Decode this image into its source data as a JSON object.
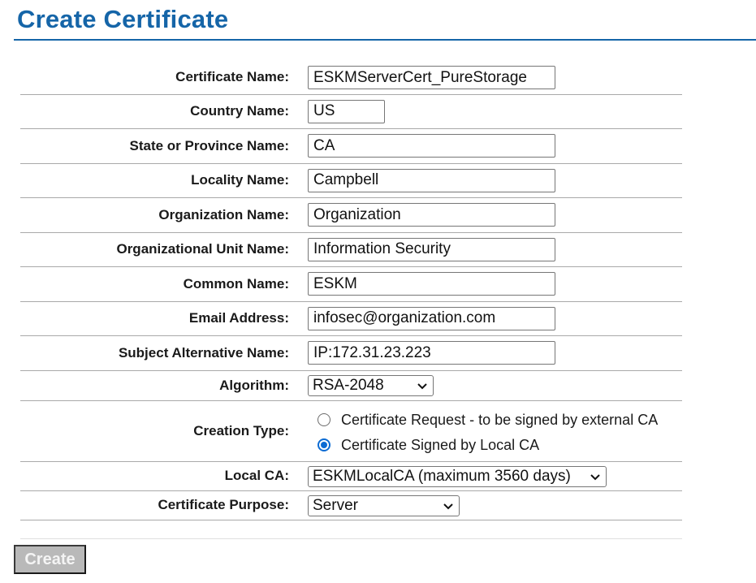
{
  "page": {
    "title": "Create Certificate",
    "accent_color": "#1565a8"
  },
  "form": {
    "certificate_name": {
      "label": "Certificate Name:",
      "value": "ESKMServerCert_PureStorage"
    },
    "country_name": {
      "label": "Country Name:",
      "value": "US"
    },
    "state_name": {
      "label": "State or Province Name:",
      "value": "CA"
    },
    "locality_name": {
      "label": "Locality Name:",
      "value": "Campbell"
    },
    "organization_name": {
      "label": "Organization Name:",
      "value": "Organization"
    },
    "org_unit_name": {
      "label": "Organizational Unit Name:",
      "value": "Information Security"
    },
    "common_name": {
      "label": "Common Name:",
      "value": "ESKM"
    },
    "email_address": {
      "label": "Email Address:",
      "value": "infosec@organization.com"
    },
    "subject_alt_name": {
      "label": "Subject Alternative Name:",
      "value": "IP:172.31.23.223"
    },
    "algorithm": {
      "label": "Algorithm:",
      "selected": "RSA-2048",
      "icon": "chevron-down-icon"
    },
    "creation_type": {
      "label": "Creation Type:",
      "options": [
        {
          "label": "Certificate Request - to be signed by external CA",
          "checked": false
        },
        {
          "label": "Certificate Signed by Local CA",
          "checked": true
        }
      ],
      "selected_color": "#0b6bd3"
    },
    "local_ca": {
      "label": "Local CA:",
      "selected": "ESKMLocalCA (maximum 3560 days)",
      "icon": "chevron-down-icon"
    },
    "certificate_purpose": {
      "label": "Certificate Purpose:",
      "selected": "Server",
      "icon": "chevron-down-icon"
    }
  },
  "actions": {
    "create_label": "Create",
    "create_disabled": true
  }
}
